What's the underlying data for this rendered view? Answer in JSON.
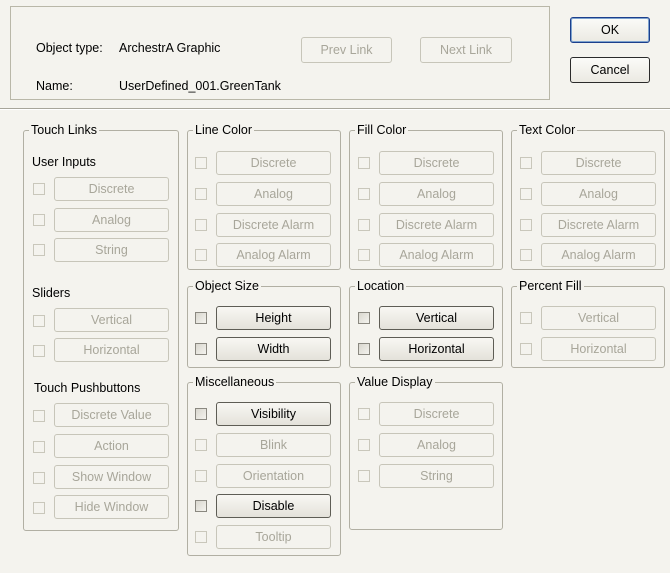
{
  "header": {
    "object_type_label": "Object type:",
    "object_type_value": "ArchestrA Graphic",
    "name_label": "Name:",
    "name_value": "UserDefined_001.GreenTank",
    "prev_link": "Prev Link",
    "next_link": "Next Link",
    "ok": "OK",
    "cancel": "Cancel"
  },
  "touch_links": {
    "title": "Touch Links",
    "user_inputs_label": "User Inputs",
    "user_inputs": [
      "Discrete",
      "Analog",
      "String"
    ],
    "sliders_label": "Sliders",
    "sliders": [
      "Vertical",
      "Horizontal"
    ],
    "pushbuttons_label": "Touch Pushbuttons",
    "pushbuttons": [
      "Discrete Value",
      "Action",
      "Show Window",
      "Hide Window"
    ]
  },
  "line_color": {
    "title": "Line Color",
    "items": [
      "Discrete",
      "Analog",
      "Discrete Alarm",
      "Analog Alarm"
    ]
  },
  "fill_color": {
    "title": "Fill Color",
    "items": [
      "Discrete",
      "Analog",
      "Discrete Alarm",
      "Analog Alarm"
    ]
  },
  "text_color": {
    "title": "Text Color",
    "items": [
      "Discrete",
      "Analog",
      "Discrete Alarm",
      "Analog Alarm"
    ]
  },
  "object_size": {
    "title": "Object Size",
    "items": [
      "Height",
      "Width"
    ]
  },
  "location": {
    "title": "Location",
    "items": [
      "Vertical",
      "Horizontal"
    ]
  },
  "percent_fill": {
    "title": "Percent Fill",
    "items": [
      "Vertical",
      "Horizontal"
    ]
  },
  "miscellaneous": {
    "title": "Miscellaneous",
    "items": [
      "Visibility",
      "Blink",
      "Orientation",
      "Disable",
      "Tooltip"
    ]
  },
  "value_display": {
    "title": "Value Display",
    "items": [
      "Discrete",
      "Analog",
      "String"
    ]
  }
}
